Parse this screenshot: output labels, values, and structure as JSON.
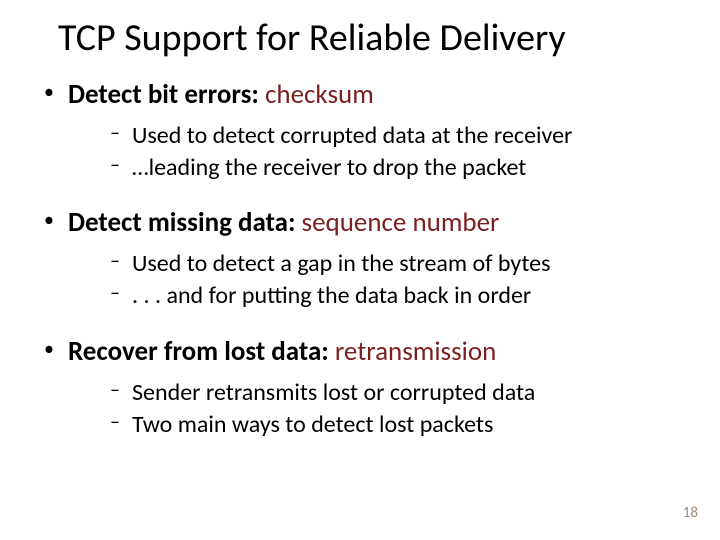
{
  "title": "TCP Support for Reliable Delivery",
  "bullets": [
    {
      "lead": "Detect bit errors:",
      "term": "checksum",
      "sub": [
        "Used to detect corrupted data at the receiver",
        "…leading the receiver to drop the packet"
      ]
    },
    {
      "lead": "Detect missing data:",
      "term": "sequence number",
      "sub": [
        "Used to detect a gap in the stream of bytes",
        ". . . and for putting the data back in order"
      ]
    },
    {
      "lead": "Recover from lost data:",
      "term": "retransmission",
      "sub": [
        "Sender retransmits lost or corrupted data",
        "Two main ways to detect lost packets"
      ]
    }
  ],
  "page_number": "18"
}
